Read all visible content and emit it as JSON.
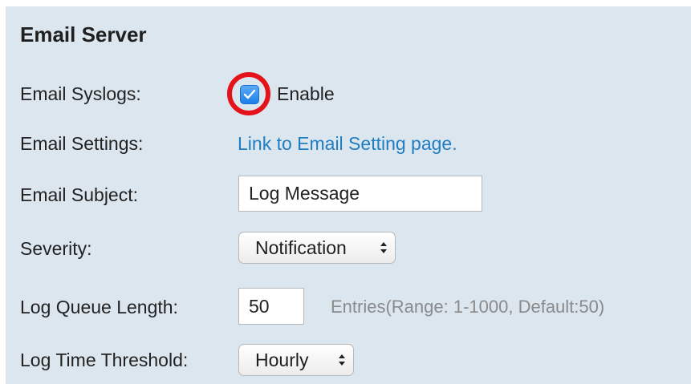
{
  "section": {
    "title": "Email Server"
  },
  "email_syslogs": {
    "label": "Email Syslogs:",
    "checkbox_checked": true,
    "checkbox_label": "Enable",
    "highlight_color": "#e3121b"
  },
  "email_settings": {
    "label": "Email Settings:",
    "link_text": "Link to Email Setting page."
  },
  "email_subject": {
    "label": "Email Subject:",
    "value": "Log Message"
  },
  "severity": {
    "label": "Severity:",
    "selected": "Notification"
  },
  "log_queue_length": {
    "label": "Log Queue Length:",
    "value": "50",
    "hint": "Entries(Range: 1-1000, Default:50)"
  },
  "log_time_threshold": {
    "label": "Log Time Threshold:",
    "selected": "Hourly"
  },
  "colors": {
    "panel_background": "#dce6ee",
    "link": "#1f7dc1",
    "checkbox_fill": "#2f8ff0"
  },
  "icons": {
    "checkbox": "checkmark-icon",
    "select_arrows": "up-down-arrows-icon"
  }
}
